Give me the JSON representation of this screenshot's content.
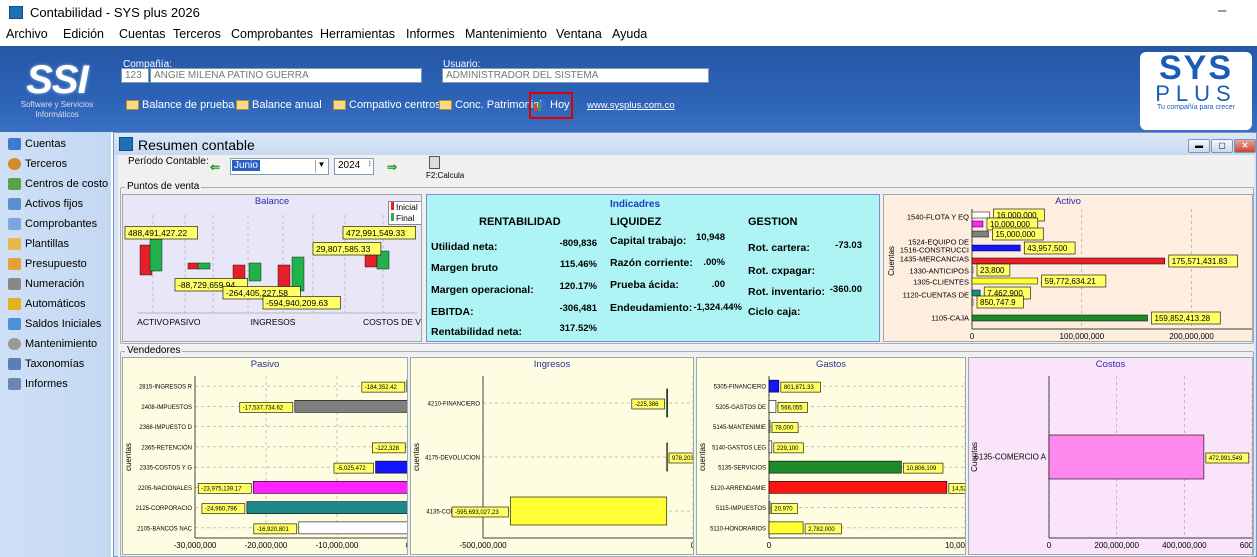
{
  "window": {
    "title": "Contabilidad - SYS plus 2026",
    "minimize": "–"
  },
  "menu": [
    "Archivo",
    "Edición",
    "Cuentas",
    "Terceros",
    "Comprobantes",
    "Herramientas",
    "Informes",
    "Mantenimiento",
    "Ventana",
    "Ayuda"
  ],
  "header": {
    "ssi_logo": {
      "big": "SSI",
      "line1": "Software y Servicios",
      "line2": "Informáticos"
    },
    "company_label": "Compañía:",
    "company_code": "123",
    "company_name": "ANGIE MILENA PATINO GUERRA",
    "user_label": "Usuario:",
    "user_name": "ADMINISTRADOR DEL SISTEMA",
    "buttons": [
      "Balance de prueba",
      "Balance anual",
      "Compativo centros",
      "Conc. Patrimonial",
      "Hoy"
    ],
    "link": "www.sysplus.com.co",
    "sys_logo": {
      "top": "SYS",
      "bottom": "PLUS",
      "tagline": "Tu compañía para crecer"
    }
  },
  "sidebar": [
    {
      "label": "Cuentas",
      "icon": "accounts-icon",
      "color": "#3d7bd0"
    },
    {
      "label": "Terceros",
      "icon": "people-icon",
      "color": "#d58a2b"
    },
    {
      "label": "Centros de costo",
      "icon": "cost-center-icon",
      "color": "#5aa24a"
    },
    {
      "label": "Activos fijos",
      "icon": "fixed-assets-icon",
      "color": "#5c8fce"
    },
    {
      "label": "Comprobantes",
      "icon": "vouchers-icon",
      "color": "#7ba6df"
    },
    {
      "label": "Plantillas",
      "icon": "templates-icon",
      "color": "#e8b84a"
    },
    {
      "label": "Presupuesto",
      "icon": "budget-icon",
      "color": "#e6a23a"
    },
    {
      "label": "Numeración",
      "icon": "numbering-icon",
      "color": "#888888"
    },
    {
      "label": "Automáticos",
      "icon": "magic-icon",
      "color": "#e3b21f"
    },
    {
      "label": "Saldos Iniciales",
      "icon": "balances-icon",
      "color": "#4f8fd6"
    },
    {
      "label": "Mantenimiento",
      "icon": "maintenance-icon",
      "color": "#9a9a9a"
    },
    {
      "label": "Taxonomías",
      "icon": "taxonomy-icon",
      "color": "#5a7fb8"
    },
    {
      "label": "Informes",
      "icon": "printer-icon",
      "color": "#6b86b3"
    }
  ],
  "summary": {
    "title": "Resumen contable",
    "period_label": "Período Contable:",
    "month": "Junio",
    "year": "2024",
    "calc_label": "F2:Calcula",
    "group_sales": "Puntos de venta",
    "group_sellers": "Vendedores"
  },
  "indicators": {
    "title": "Indicadres",
    "rentabilidad": {
      "heading": "RENTABILIDAD",
      "rows": [
        {
          "label": "Utilidad neta:",
          "value": "-809,836"
        },
        {
          "label": "Margen bruto",
          "value": "115.46%"
        },
        {
          "label": "Margen operacional:",
          "value": "120.17%"
        },
        {
          "label": "EBITDA:",
          "value": "-306,481"
        },
        {
          "label": "Rentabilidad neta:",
          "value": "317.52%"
        }
      ]
    },
    "liquidez": {
      "heading": "LIQUIDEZ",
      "rows": [
        {
          "label": "Capital trabajo:",
          "value": "10,948"
        },
        {
          "label": "Razón corriente:",
          "value": ".00%"
        },
        {
          "label": "Prueba ácida:",
          "value": ".00"
        },
        {
          "label": "Endeudamiento:",
          "value": "-1,324.44%"
        }
      ]
    },
    "gestion": {
      "heading": "GESTION",
      "rows": [
        {
          "label": "Rot. cartera:",
          "value": "-73.03"
        },
        {
          "label": "Rot. cxpagar:",
          "value": ""
        },
        {
          "label": "Rot. inventario:",
          "value": "-360.00"
        },
        {
          "label": "Ciclo caja:",
          "value": ""
        }
      ]
    }
  },
  "chart_data": [
    {
      "type": "bar",
      "title": "Balance",
      "categories": [
        "ACTIVO",
        "PASIVO",
        "INGRESOS",
        "COSTOS DE VENTA"
      ],
      "series": [
        {
          "name": "Inicial",
          "color": "#e4202a"
        },
        {
          "name": "Final",
          "color": "#22b14c"
        }
      ],
      "value_labels": [
        "488,491,427.22",
        "-88,729,659.94",
        "-264,405,227.58",
        "-594,940,209.63",
        "29,807,585.33",
        "472,991,549.33"
      ]
    },
    {
      "type": "bar",
      "orientation": "horizontal",
      "title": "Activo",
      "categories": [
        "1540-FLOTA Y EQ",
        "1524-EQUIPO DE",
        "1516-CONSTRUCCI",
        "1435-MERCANCIAS",
        "1330-ANTICIPOS",
        "1305-CLIENTES",
        "1120-CUENTAS DE",
        "1105-CAJA"
      ],
      "values": [
        16000000,
        10000000,
        15000000,
        43957500,
        175571431.83,
        23800,
        59772634.21,
        7462900,
        850747.9,
        159852413.28
      ],
      "value_labels": [
        "16,000,000",
        "10,000,000",
        "15,000,000",
        "43,957,500",
        "175,571,431.83",
        "23,800",
        "59,772,634.21",
        "7,462,900",
        "850,747.9",
        "159,852,413.28"
      ],
      "ylabel": "Cuentas",
      "x_ticks": [
        "0",
        "100,000,000",
        "200,000,000"
      ],
      "xlim": [
        0,
        255000000
      ]
    },
    {
      "type": "bar",
      "orientation": "horizontal",
      "title": "Pasivo",
      "ylabel": "cuentas",
      "categories": [
        "2815-INGRESOS R",
        "2408-IMPUESTOS",
        "2368-IMPUESTO D",
        "2365-RETENCIÓN",
        "2335-COSTOS Y G",
        "2205-NACIONALES",
        "2125-CORPORACIO",
        "2105-BANCOS NAC"
      ],
      "values": [
        -184352.42,
        -17537734.62,
        0,
        -122328,
        -5025472,
        -23975139.17,
        -24960796,
        -16920801
      ],
      "value_labels": [
        "-184,352.42",
        "-17,537,734.62",
        "",
        "-122,328",
        "-5,025,472",
        "-23,975,139.17",
        "-24,960,796",
        "-16,920,801"
      ],
      "colors": [
        "#ffffff",
        "#808080",
        "#ffffff",
        "#ffffff",
        "#1414ff",
        "#ff22ff",
        "#1d8a8a",
        "#ffffff"
      ],
      "x_ticks": [
        "-30,000,000",
        "-20,000,000",
        "-10,000,000",
        "0"
      ],
      "xlim": [
        -33000000,
        0
      ]
    },
    {
      "type": "bar",
      "orientation": "horizontal",
      "title": "Ingresos",
      "ylabel": "cuentas",
      "categories": [
        "4210-FINANCIERO",
        "4175-DEVOLUCION",
        "4135-COMERCIO A"
      ],
      "values": [
        -225386,
        978203.6,
        -595693027.23
      ],
      "value_labels": [
        "-225,386",
        "978,203.6",
        "-595,693,027.23"
      ],
      "colors": [
        "#22b14c",
        "#ffff33",
        "#ffff33"
      ],
      "x_ticks": [
        "-500,000,000",
        "0"
      ],
      "xlim": [
        -700000000,
        100000000
      ]
    },
    {
      "type": "bar",
      "orientation": "horizontal",
      "title": "Gastos",
      "ylabel": "cuentas",
      "categories": [
        "5305-FINANCIERO",
        "5205-GASTOS DE",
        "5145-MANTENIMIE",
        "5140-GASTOS LEG",
        "5135-SERVICIOS",
        "5120-ARRENDAMIE",
        "5115-IMPUESTOS",
        "5110-HONORARIOS"
      ],
      "values": [
        801871.33,
        566055,
        78000,
        229100,
        10806109,
        14520000,
        20970,
        2782000
      ],
      "value_labels": [
        "801,871.33",
        "566,055",
        "78,000",
        "229,100",
        "10,806,109",
        "14,52",
        "20,970",
        "2,782,000"
      ],
      "colors": [
        "#1414ff",
        "#ffffff",
        "#ffffff",
        "#ffffff",
        "#1d8a2a",
        "#ff1414",
        "#ffffff",
        "#ffff33"
      ],
      "x_ticks": [
        "0",
        "10,000,000"
      ],
      "xlim": [
        0,
        16000000
      ]
    },
    {
      "type": "bar",
      "orientation": "horizontal",
      "title": "Costos",
      "ylabel": "Cuentas",
      "categories": [
        "6135-COMERCIO A"
      ],
      "values": [
        472991549.33
      ],
      "value_labels": [
        "472,991,549"
      ],
      "colors": [
        "#ff88ee"
      ],
      "x_ticks": [
        "0",
        "200,000,000",
        "400,000,000",
        "600,00"
      ],
      "xlim": [
        0,
        620000000
      ]
    }
  ]
}
